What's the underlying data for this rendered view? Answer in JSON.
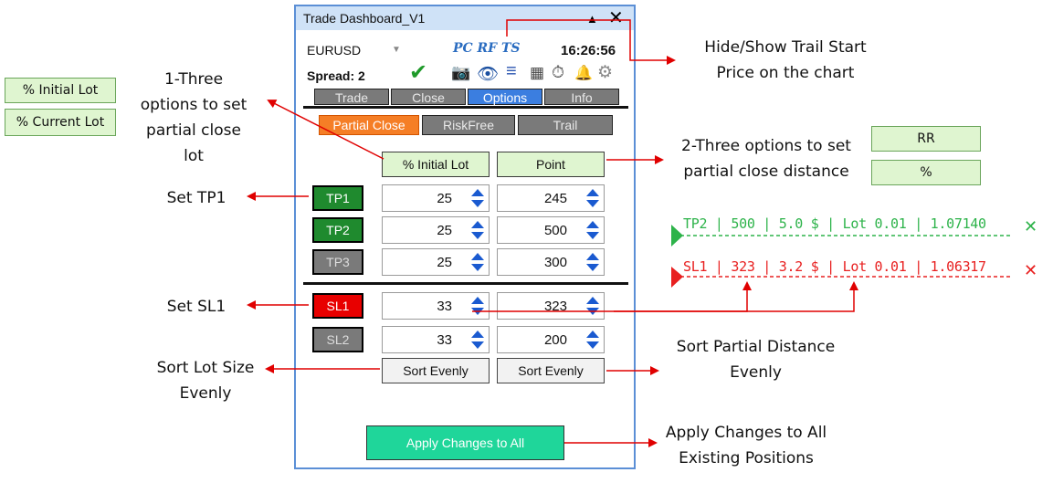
{
  "annotations": {
    "trail_start": [
      "Hide/Show Trail Start",
      "Price on the chart"
    ],
    "partial_lot": [
      "1-Three",
      "options to set",
      "partial close",
      "lot"
    ],
    "partial_distance": [
      "2-Three options to set",
      "partial close distance"
    ],
    "set_tp1": "Set  TP1",
    "set_sl1": "Set  SL1",
    "sort_lot": [
      "Sort Lot Size",
      "Evenly"
    ],
    "sort_distance": [
      "Sort Partial Distance",
      "Evenly"
    ],
    "apply_all": [
      "Apply Changes to All",
      "Existing Positions"
    ]
  },
  "side_options_left": [
    "% Initial Lot",
    "% Current Lot"
  ],
  "side_options_right": [
    "RR",
    "%"
  ],
  "chart_lines": {
    "tp": "TP2 | 500 | 5.0 $ | Lot 0.01 | 1.07140",
    "sl": "SL1 | 323 | 3.2 $ | Lot 0.01 | 1.06317"
  },
  "panel": {
    "title": "Trade Dashboard_V1",
    "symbol": "EURUSD",
    "mode_icons": "PC  RF  TS",
    "time": "16:26:56",
    "spread": "Spread: 2",
    "tabs": [
      "Trade",
      "Close",
      "Options",
      "Info"
    ],
    "subtabs": [
      "Partial Close",
      "RiskFree",
      "Trail"
    ],
    "lot_header": "% Initial Lot",
    "distance_header": "Point",
    "rows": [
      {
        "label": "TP1",
        "lot": "25",
        "dist": "245"
      },
      {
        "label": "TP2",
        "lot": "25",
        "dist": "500"
      },
      {
        "label": "TP3",
        "lot": "25",
        "dist": "300"
      },
      {
        "label": "SL1",
        "lot": "33",
        "dist": "323"
      },
      {
        "label": "SL2",
        "lot": "33",
        "dist": "200"
      }
    ],
    "sort_lot": "Sort Evenly",
    "sort_distance": "Sort Evenly",
    "apply": "Apply Changes to All"
  },
  "colors": {
    "arrow": "#e00000",
    "tp_line": "#2db34a",
    "sl_line": "#e82020",
    "tp_active": "#1f8a2e",
    "sl_active": "#e80000",
    "inactive": "#7a7a7a",
    "apply": "#1fd69a"
  }
}
